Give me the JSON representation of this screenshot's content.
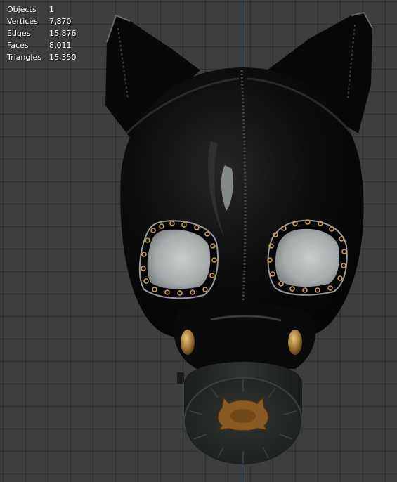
{
  "statistics": [
    {
      "label": "Objects",
      "value": "1"
    },
    {
      "label": "Vertices",
      "value": "7,870"
    },
    {
      "label": "Edges",
      "value": "15,876"
    },
    {
      "label": "Faces",
      "value": "8,011"
    },
    {
      "label": "Triangles",
      "value": "15,350"
    }
  ],
  "colors": {
    "viewport_bg": "#3e3e3e",
    "axis_line": "#4a6fb0",
    "latex": "#0a0a0a",
    "lens": "#b4b8b9",
    "filter": "#262b29",
    "brass": "#b38a3d",
    "valve_plate": "#8a5a24"
  }
}
